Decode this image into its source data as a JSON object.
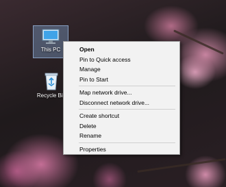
{
  "desktop": {
    "icons": [
      {
        "label": "This PC",
        "icon": "computer-monitor-icon"
      },
      {
        "label": "Recycle Bin",
        "icon": "recycle-bin-icon"
      }
    ]
  },
  "context_menu": {
    "groups": [
      [
        {
          "label": "Open",
          "bold": true
        },
        {
          "label": "Pin to Quick access"
        },
        {
          "label": "Manage"
        },
        {
          "label": "Pin to Start"
        }
      ],
      [
        {
          "label": "Map network drive..."
        },
        {
          "label": "Disconnect network drive..."
        }
      ],
      [
        {
          "label": "Create shortcut"
        },
        {
          "label": "Delete"
        },
        {
          "label": "Rename"
        }
      ],
      [
        {
          "label": "Properties"
        }
      ]
    ]
  },
  "colors": {
    "menu_background": "#f2f2f2",
    "selection_highlight": "#7896be"
  }
}
